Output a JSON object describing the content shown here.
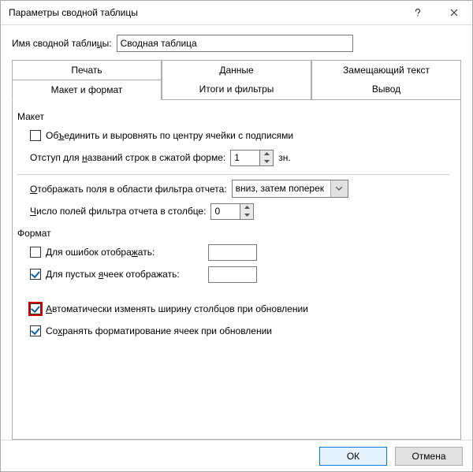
{
  "title": "Параметры сводной таблицы",
  "nameLabelPre": "Имя сводной табли",
  "nameLabelU": "ц",
  "nameLabelPost": "ы:",
  "nameValue": "Сводная таблица",
  "tabs": {
    "print": "Печать",
    "data": "Данные",
    "altText": "Замещающий текст",
    "layout": "Макет и формат",
    "totals": "Итоги и фильтры",
    "output": "Вывод"
  },
  "groups": {
    "layout": "Макет",
    "format": "Формат"
  },
  "layoutSection": {
    "merge": {
      "pre": "Об",
      "u": "ъ",
      "post": "единить и выровнять по центру ячейки с подписями"
    },
    "indent": {
      "pre": "Отступ для ",
      "u": "н",
      "post": "азваний строк в сжатой форме:",
      "value": "1",
      "unit": "зн."
    },
    "display": {
      "u": "О",
      "post": "тображать поля в области фильтра отчета:",
      "value": "вниз, затем поперек"
    },
    "count": {
      "u": "Ч",
      "post": "исло полей фильтра отчета в столбце:",
      "value": "0"
    }
  },
  "formatSection": {
    "errors": {
      "pre": "Для ошибок отобра",
      "u": "ж",
      "post": "ать:"
    },
    "empty": {
      "pre": "Для пустых ",
      "u": "я",
      "post": "чеек отображать:"
    },
    "autowidth": {
      "u": "А",
      "post": "втоматически изменять ширину столбцов при обновлении"
    },
    "preserve": {
      "pre": "Со",
      "u": "х",
      "post": "ранять форматирование ячеек при обновлении"
    }
  },
  "buttons": {
    "ok": "ОК",
    "cancel": "Отмена"
  }
}
